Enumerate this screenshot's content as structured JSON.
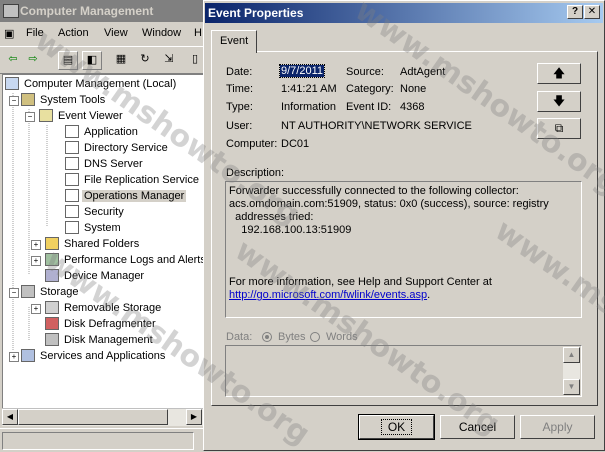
{
  "bg_window": {
    "title": "Computer Management",
    "menu": [
      "File",
      "Action",
      "View",
      "Window",
      "H"
    ],
    "tree": [
      {
        "label": "Computer Management (Local)",
        "icon": "computer-icon"
      },
      {
        "label": "System Tools",
        "icon": "tools-icon"
      },
      {
        "label": "Event Viewer",
        "icon": "event-viewer-icon"
      },
      {
        "label": "Application",
        "icon": "log-icon"
      },
      {
        "label": "Directory Service",
        "icon": "log-icon"
      },
      {
        "label": "DNS Server",
        "icon": "log-icon"
      },
      {
        "label": "File Replication Service",
        "icon": "log-icon"
      },
      {
        "label": "Operations Manager",
        "icon": "log-icon"
      },
      {
        "label": "Security",
        "icon": "log-icon"
      },
      {
        "label": "System",
        "icon": "log-icon"
      },
      {
        "label": "Shared Folders",
        "icon": "folder-icon"
      },
      {
        "label": "Performance Logs and Alerts",
        "icon": "perf-icon"
      },
      {
        "label": "Device Manager",
        "icon": "device-icon"
      },
      {
        "label": "Storage",
        "icon": "storage-icon"
      },
      {
        "label": "Removable Storage",
        "icon": "removable-icon"
      },
      {
        "label": "Disk Defragmenter",
        "icon": "defrag-icon"
      },
      {
        "label": "Disk Management",
        "icon": "disk-icon"
      },
      {
        "label": "Services and Applications",
        "icon": "services-icon"
      }
    ]
  },
  "dialog": {
    "title": "Event Properties",
    "tab": "Event",
    "fields": {
      "date_label": "Date:",
      "date_value": "9/7/2011",
      "source_label": "Source:",
      "source_value": "AdtAgent",
      "time_label": "Time:",
      "time_value": "1:41:21 AM",
      "category_label": "Category:",
      "category_value": "None",
      "type_label": "Type:",
      "type_value": "Information",
      "eventid_label": "Event ID:",
      "eventid_value": "4368",
      "user_label": "User:",
      "user_value": "NT AUTHORITY\\NETWORK SERVICE",
      "computer_label": "Computer:",
      "computer_value": "DC01"
    },
    "description_label": "Description:",
    "description_lines": [
      "Forwarder successfully connected to the following collector:",
      "acs.omdomain.com:51909, status: 0x0 (success), source: registry",
      "  addresses tried:",
      "    192.168.100.13:51909",
      "For more information, see Help and Support Center at"
    ],
    "description_link": "http://go.microsoft.com/fwlink/events.asp",
    "description_link_suffix": ".",
    "data_label": "Data:",
    "bytes_label": "Bytes",
    "words_label": "Words",
    "buttons": {
      "ok": "OK",
      "cancel": "Cancel",
      "apply": "Apply"
    },
    "nav_icons": [
      "up-arrow-icon",
      "down-arrow-icon",
      "copy-icon"
    ]
  },
  "watermark": "www.mshowto.org",
  "colors": {
    "title_active": "#0a246a",
    "title_inactive": "#808080",
    "link": "#0000cc",
    "face": "#d4d0c8"
  }
}
